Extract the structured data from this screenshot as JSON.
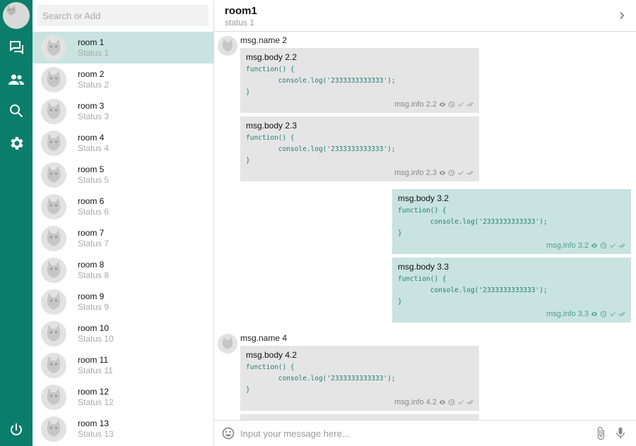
{
  "theme": {
    "accent": "#0b7d6b",
    "selected": "#c8e3e0",
    "incoming_bubble": "#e5e5e5",
    "outgoing_bubble": "#c8e3e0"
  },
  "sidebar": {
    "icons": [
      "chat-icon",
      "people-icon",
      "search-icon",
      "settings-icon",
      "power-icon"
    ]
  },
  "search": {
    "placeholder": "Search or Add"
  },
  "rooms": [
    {
      "name": "room 1",
      "status": "Status 1"
    },
    {
      "name": "room 2",
      "status": "Status 2"
    },
    {
      "name": "room 3",
      "status": "Status 3"
    },
    {
      "name": "room 4",
      "status": "Status 4"
    },
    {
      "name": "room 5",
      "status": "Status 5"
    },
    {
      "name": "room 6",
      "status": "Status 6"
    },
    {
      "name": "room 7",
      "status": "Status 7"
    },
    {
      "name": "room 8",
      "status": "Status 8"
    },
    {
      "name": "room 9",
      "status": "Status 9"
    },
    {
      "name": "room 10",
      "status": "Status 10"
    },
    {
      "name": "room 11",
      "status": "Status 11"
    },
    {
      "name": "room 12",
      "status": "Status 12"
    },
    {
      "name": "room 13",
      "status": "Status 13"
    }
  ],
  "chat": {
    "title": "room1",
    "status": "status 1",
    "messages": [
      {
        "sender": "msg.name 2"
      },
      {
        "body": "msg.body 2.2",
        "code": "function() {\n        console.log('2333333333333');\n}",
        "info": "msg.info 2.2"
      },
      {
        "body": "msg.body 2.3",
        "code": "function() {\n        console.log('2333333333333');\n}",
        "info": "msg.info 2.3"
      },
      {
        "body": "msg.body 3.2",
        "code": "function() {\n        console.log('2333333333333');\n}",
        "info": "msg.info 3.2"
      },
      {
        "body": "msg.body 3.3",
        "code": "function() {\n        console.log('2333333333333');\n}",
        "info": "msg.info 3.3"
      },
      {
        "sender": "msg.name 4"
      },
      {
        "body": "msg.body 4.2",
        "code": "function() {\n        console.log('2333333333333');\n}",
        "info": "msg.info 4.2"
      }
    ]
  },
  "composer": {
    "placeholder": "Input your message here..."
  }
}
